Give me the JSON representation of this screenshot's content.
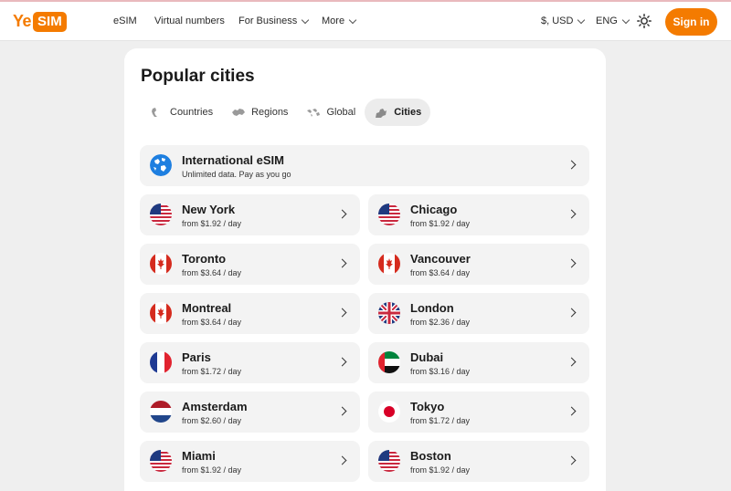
{
  "header": {
    "logo": {
      "ye": "Ye",
      "sim": "SIM"
    },
    "nav": [
      "eSIM",
      "Virtual numbers",
      "For Business",
      "More"
    ],
    "currency": "$, USD",
    "language": "ENG",
    "sign_in": "Sign in"
  },
  "main": {
    "title": "Popular cities",
    "tabs": [
      {
        "label": "Countries",
        "icon": "map-icon",
        "active": false
      },
      {
        "label": "Regions",
        "icon": "region-map-icon",
        "active": false
      },
      {
        "label": "Global",
        "icon": "world-map-icon",
        "active": false
      },
      {
        "label": "Cities",
        "icon": "city-icon",
        "active": true
      }
    ],
    "international": {
      "title": "International eSIM",
      "subtitle": "Unlimited data. Pay as you go",
      "icon": "globe-icon"
    },
    "cities": [
      {
        "name": "New York",
        "price": "from $1.92 / day",
        "flag": "us-flag-icon"
      },
      {
        "name": "Chicago",
        "price": "from $1.92 / day",
        "flag": "us-flag-icon"
      },
      {
        "name": "Toronto",
        "price": "from $3.64 / day",
        "flag": "canada-flag-icon"
      },
      {
        "name": "Vancouver",
        "price": "from $3.64 / day",
        "flag": "canada-flag-icon"
      },
      {
        "name": "Montreal",
        "price": "from $3.64 / day",
        "flag": "canada-flag-icon"
      },
      {
        "name": "London",
        "price": "from $2.36 / day",
        "flag": "uk-flag-icon"
      },
      {
        "name": "Paris",
        "price": "from $1.72 / day",
        "flag": "france-flag-icon"
      },
      {
        "name": "Dubai",
        "price": "from $3.16 / day",
        "flag": "uae-flag-icon"
      },
      {
        "name": "Amsterdam",
        "price": "from $2.60 / day",
        "flag": "netherlands-flag-icon"
      },
      {
        "name": "Tokyo",
        "price": "from $1.72 / day",
        "flag": "japan-flag-icon"
      },
      {
        "name": "Miami",
        "price": "from $1.92 / day",
        "flag": "us-flag-icon"
      },
      {
        "name": "Boston",
        "price": "from $1.92 / day",
        "flag": "us-flag-icon"
      }
    ]
  },
  "colors": {
    "accent": "#f47b00",
    "card_bg": "#ffffff",
    "page_bg": "#efefef",
    "row_bg": "#f3f3f3"
  }
}
